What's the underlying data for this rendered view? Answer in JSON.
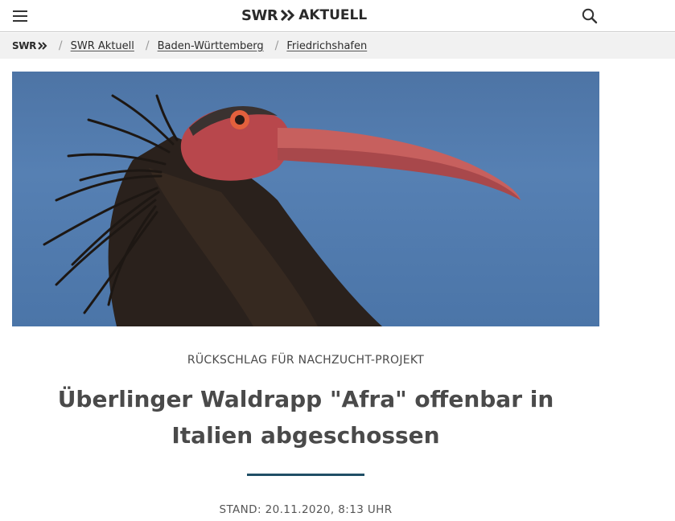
{
  "header": {
    "menu_icon": "hamburger-menu-icon",
    "logo_brand": "SWR",
    "logo_title": "AKTUELL",
    "search_icon": "search-icon"
  },
  "breadcrumb": {
    "home": "SWR",
    "separator": "/",
    "items": [
      {
        "label": "SWR Aktuell"
      },
      {
        "label": "Baden-Württemberg"
      },
      {
        "label": "Friedrichshafen"
      }
    ]
  },
  "hero_image": {
    "subject": "bald-ibis-photo"
  },
  "article": {
    "kicker": "RÜCKSCHLAG FÜR NACHZUCHT-PROJEKT",
    "headline": "Überlinger Waldrapp \"Afra\" offenbar in Italien abgeschossen",
    "stand": "STAND: 20.11.2020, 8:13 UHR"
  },
  "colors": {
    "accent_rule": "#1f4e66",
    "breadcrumb_bg": "#f1f1f1",
    "sky": "#5680b3"
  }
}
